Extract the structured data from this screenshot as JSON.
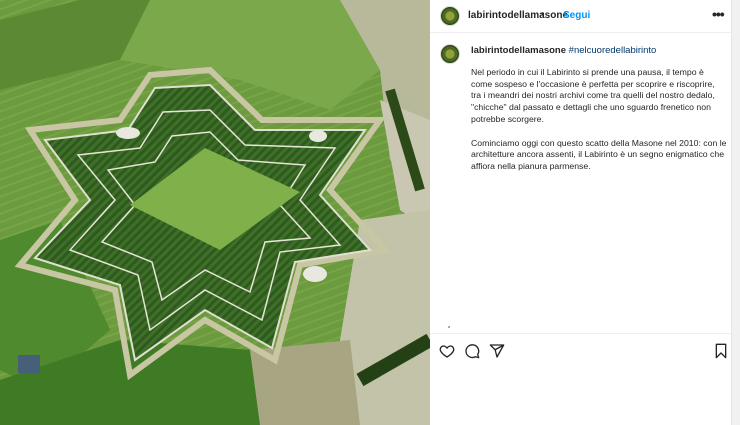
{
  "post": {
    "image_alt_icon": "maze-photo",
    "header": {
      "username": "labirintodellamasone",
      "separator": "•",
      "follow_label": "Segui",
      "more_icon": "more-horizontal-icon",
      "more_label": "•••"
    },
    "caption": {
      "username": "labirintodellamasone",
      "hashtag": "#nelcuoredellabirinto",
      "paragraph1": "Nel periodo in cui il Labirinto si prende una pausa, il tempo è come sospeso e l'occasione è perfetta per scoprire e riscoprire, tra i meandri dei nostri archivi come tra quelli del nostro dedalo, \"chicche\" dal passato e dettagli che uno sguardo frenetico non potrebbe scorgere.",
      "paragraph2": "Cominciamo oggi con questo scatto della Masone nel 2010: con le architetture ancora assenti, il Labirinto è un segno enigmatico che affiora nella pianura parmense."
    },
    "actions": {
      "like_icon": "heart-icon",
      "comment_icon": "comment-icon",
      "share_icon": "share-icon",
      "save_icon": "bookmark-icon"
    }
  },
  "colors": {
    "accent": "#0095f6",
    "hashtag": "#00376b",
    "text": "#262626"
  }
}
